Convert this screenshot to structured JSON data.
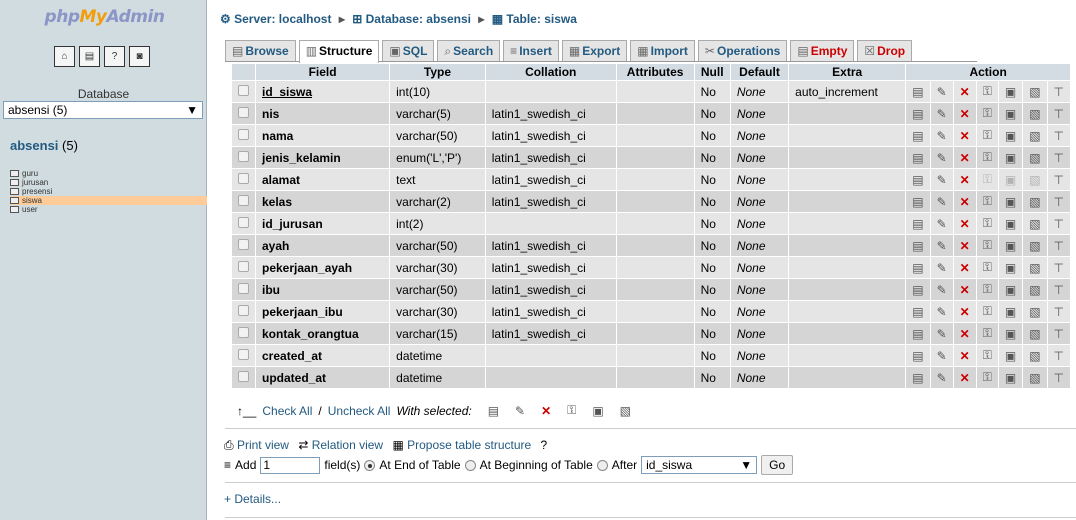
{
  "logo": {
    "p1": "php",
    "p2": "My",
    "p3": "Admin"
  },
  "sidebar": {
    "database_label": "Database",
    "database_select": "absensi (5)",
    "db_name": "absensi",
    "db_count": "(5)",
    "tables": [
      "guru",
      "jurusan",
      "presensi",
      "siswa",
      "user"
    ],
    "selected_table": "siswa"
  },
  "breadcrumb": {
    "server": "Server: localhost",
    "database": "Database: absensi",
    "table": "Table: siswa"
  },
  "tabs": [
    "Browse",
    "Structure",
    "SQL",
    "Search",
    "Insert",
    "Export",
    "Import",
    "Operations",
    "Empty",
    "Drop"
  ],
  "table_headers": {
    "field": "Field",
    "type": "Type",
    "collation": "Collation",
    "attributes": "Attributes",
    "null": "Null",
    "default": "Default",
    "extra": "Extra",
    "action": "Action"
  },
  "rows": [
    {
      "field": "id_siswa",
      "type": "int(10)",
      "collation": "",
      "null": "No",
      "default": "None",
      "extra": "auto_increment"
    },
    {
      "field": "nis",
      "type": "varchar(5)",
      "collation": "latin1_swedish_ci",
      "null": "No",
      "default": "None",
      "extra": ""
    },
    {
      "field": "nama",
      "type": "varchar(50)",
      "collation": "latin1_swedish_ci",
      "null": "No",
      "default": "None",
      "extra": ""
    },
    {
      "field": "jenis_kelamin",
      "type": "enum('L','P')",
      "collation": "latin1_swedish_ci",
      "null": "No",
      "default": "None",
      "extra": ""
    },
    {
      "field": "alamat",
      "type": "text",
      "collation": "latin1_swedish_ci",
      "null": "No",
      "default": "None",
      "extra": ""
    },
    {
      "field": "kelas",
      "type": "varchar(2)",
      "collation": "latin1_swedish_ci",
      "null": "No",
      "default": "None",
      "extra": ""
    },
    {
      "field": "id_jurusan",
      "type": "int(2)",
      "collation": "",
      "null": "No",
      "default": "None",
      "extra": ""
    },
    {
      "field": "ayah",
      "type": "varchar(50)",
      "collation": "latin1_swedish_ci",
      "null": "No",
      "default": "None",
      "extra": ""
    },
    {
      "field": "pekerjaan_ayah",
      "type": "varchar(30)",
      "collation": "latin1_swedish_ci",
      "null": "No",
      "default": "None",
      "extra": ""
    },
    {
      "field": "ibu",
      "type": "varchar(50)",
      "collation": "latin1_swedish_ci",
      "null": "No",
      "default": "None",
      "extra": ""
    },
    {
      "field": "pekerjaan_ibu",
      "type": "varchar(30)",
      "collation": "latin1_swedish_ci",
      "null": "No",
      "default": "None",
      "extra": ""
    },
    {
      "field": "kontak_orangtua",
      "type": "varchar(15)",
      "collation": "latin1_swedish_ci",
      "null": "No",
      "default": "None",
      "extra": ""
    },
    {
      "field": "created_at",
      "type": "datetime",
      "collation": "",
      "null": "No",
      "default": "None",
      "extra": ""
    },
    {
      "field": "updated_at",
      "type": "datetime",
      "collation": "",
      "null": "No",
      "default": "None",
      "extra": ""
    }
  ],
  "footer": {
    "check_all": "Check All",
    "slash": " / ",
    "uncheck_all": "Uncheck All",
    "with_selected": "With selected:",
    "print_view": "Print view",
    "relation_view": "Relation view",
    "propose": "Propose table structure",
    "add_label": "Add",
    "add_value": "1",
    "fields_label": "field(s)",
    "end_of_table": "At End of Table",
    "beginning": "At Beginning of Table",
    "after": "After",
    "after_select": "id_siswa",
    "go": "Go",
    "details": "+ Details..."
  }
}
